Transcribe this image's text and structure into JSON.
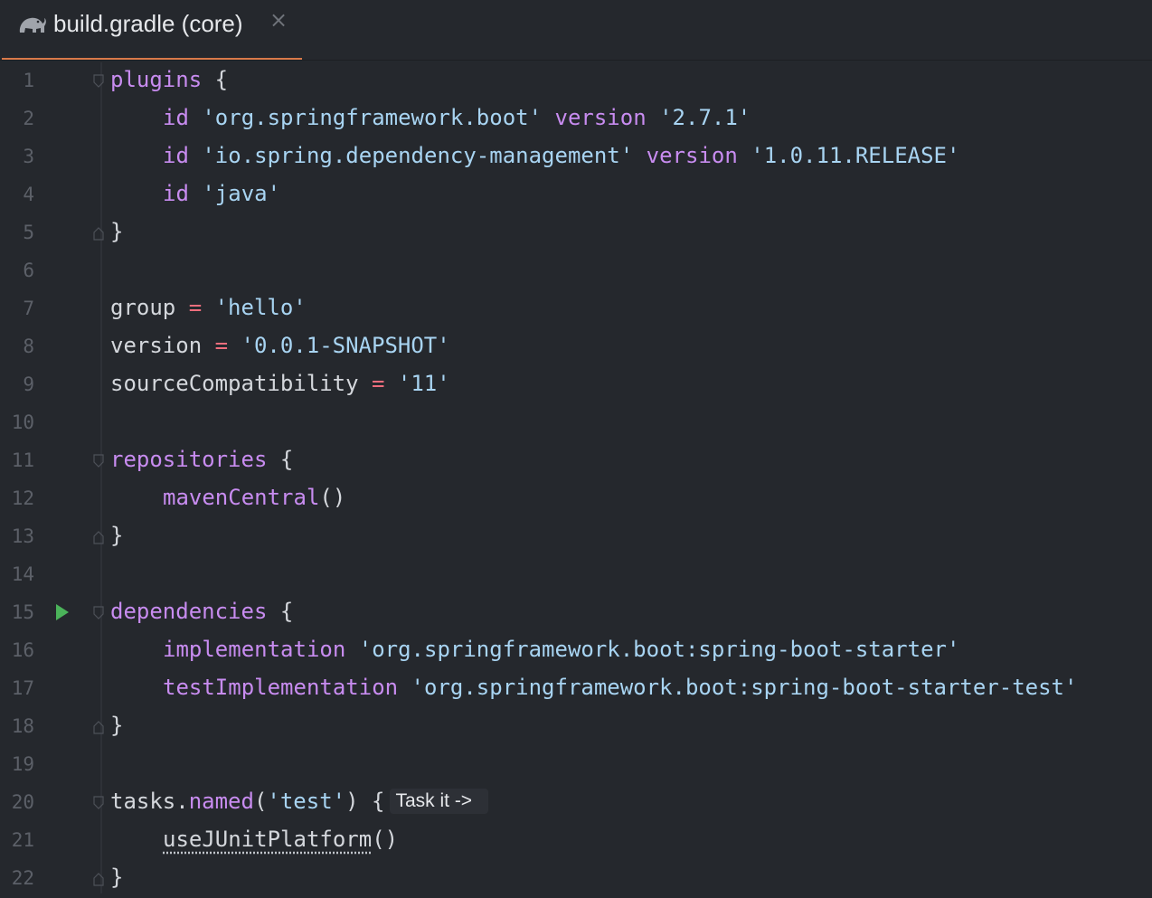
{
  "tab": {
    "title": "build.gradle (core)",
    "close": "×",
    "icon": "gradle-elephant-icon"
  },
  "colors": {
    "accent": "#d97a4a",
    "background": "#25282d",
    "keyword": "#c88cf0",
    "string": "#a8d4f2",
    "operator": "#ef6e7d",
    "run": "#4bb35a"
  },
  "lines": [
    {
      "n": "1",
      "indent": 0,
      "tokens": [
        [
          "kw",
          "plugins"
        ],
        [
          "pl",
          " {"
        ]
      ],
      "fold": "open"
    },
    {
      "n": "2",
      "indent": 1,
      "tokens": [
        [
          "kw",
          "id"
        ],
        [
          "pl",
          " "
        ],
        [
          "str",
          "'org.springframework.boot'"
        ],
        [
          "pl",
          " "
        ],
        [
          "kw",
          "version"
        ],
        [
          "pl",
          " "
        ],
        [
          "str",
          "'2.7.1'"
        ]
      ]
    },
    {
      "n": "3",
      "indent": 1,
      "tokens": [
        [
          "kw",
          "id"
        ],
        [
          "pl",
          " "
        ],
        [
          "str",
          "'io.spring.dependency-management'"
        ],
        [
          "pl",
          " "
        ],
        [
          "kw",
          "version"
        ],
        [
          "pl",
          " "
        ],
        [
          "str",
          "'1.0.11.RELEASE'"
        ]
      ]
    },
    {
      "n": "4",
      "indent": 1,
      "tokens": [
        [
          "kw",
          "id"
        ],
        [
          "pl",
          " "
        ],
        [
          "str",
          "'java'"
        ]
      ]
    },
    {
      "n": "5",
      "indent": 0,
      "tokens": [
        [
          "pl",
          "}"
        ]
      ],
      "fold": "close"
    },
    {
      "n": "6",
      "indent": 0,
      "tokens": []
    },
    {
      "n": "7",
      "indent": 0,
      "tokens": [
        [
          "pl",
          "group "
        ],
        [
          "op",
          "="
        ],
        [
          "pl",
          " "
        ],
        [
          "str",
          "'hello'"
        ]
      ]
    },
    {
      "n": "8",
      "indent": 0,
      "tokens": [
        [
          "pl",
          "version "
        ],
        [
          "op",
          "="
        ],
        [
          "pl",
          " "
        ],
        [
          "str",
          "'0.0.1-SNAPSHOT'"
        ]
      ]
    },
    {
      "n": "9",
      "indent": 0,
      "tokens": [
        [
          "pl",
          "sourceCompatibility "
        ],
        [
          "op",
          "="
        ],
        [
          "pl",
          " "
        ],
        [
          "str",
          "'11'"
        ]
      ]
    },
    {
      "n": "10",
      "indent": 0,
      "tokens": []
    },
    {
      "n": "11",
      "indent": 0,
      "tokens": [
        [
          "kw",
          "repositories"
        ],
        [
          "pl",
          " {"
        ]
      ],
      "fold": "open"
    },
    {
      "n": "12",
      "indent": 1,
      "tokens": [
        [
          "fn",
          "mavenCentral"
        ],
        [
          "pl",
          "()"
        ]
      ]
    },
    {
      "n": "13",
      "indent": 0,
      "tokens": [
        [
          "pl",
          "}"
        ]
      ],
      "fold": "close"
    },
    {
      "n": "14",
      "indent": 0,
      "tokens": []
    },
    {
      "n": "15",
      "indent": 0,
      "tokens": [
        [
          "kw",
          "dependencies"
        ],
        [
          "pl",
          " {"
        ]
      ],
      "fold": "open",
      "run": true
    },
    {
      "n": "16",
      "indent": 1,
      "tokens": [
        [
          "kw",
          "implementation"
        ],
        [
          "pl",
          " "
        ],
        [
          "str",
          "'org.springframework.boot:spring-boot-starter'"
        ]
      ]
    },
    {
      "n": "17",
      "indent": 1,
      "tokens": [
        [
          "kw",
          "testImplementation"
        ],
        [
          "pl",
          " "
        ],
        [
          "str",
          "'org.springframework.boot:spring-boot-starter-test'"
        ]
      ]
    },
    {
      "n": "18",
      "indent": 0,
      "tokens": [
        [
          "pl",
          "}"
        ]
      ],
      "fold": "close"
    },
    {
      "n": "19",
      "indent": 0,
      "tokens": []
    },
    {
      "n": "20",
      "indent": 0,
      "tokens": [
        [
          "pl",
          "tasks."
        ],
        [
          "fn",
          "named"
        ],
        [
          "pl",
          "("
        ],
        [
          "str",
          "'test'"
        ],
        [
          "pl",
          ") {"
        ]
      ],
      "fold": "open",
      "hint": "Task it ->"
    },
    {
      "n": "21",
      "indent": 1,
      "tokens": [
        [
          "squiggle",
          "useJUnitPlatform"
        ],
        [
          "pl",
          "()"
        ]
      ]
    },
    {
      "n": "22",
      "indent": 0,
      "tokens": [
        [
          "pl",
          "}"
        ]
      ],
      "fold": "close"
    }
  ]
}
